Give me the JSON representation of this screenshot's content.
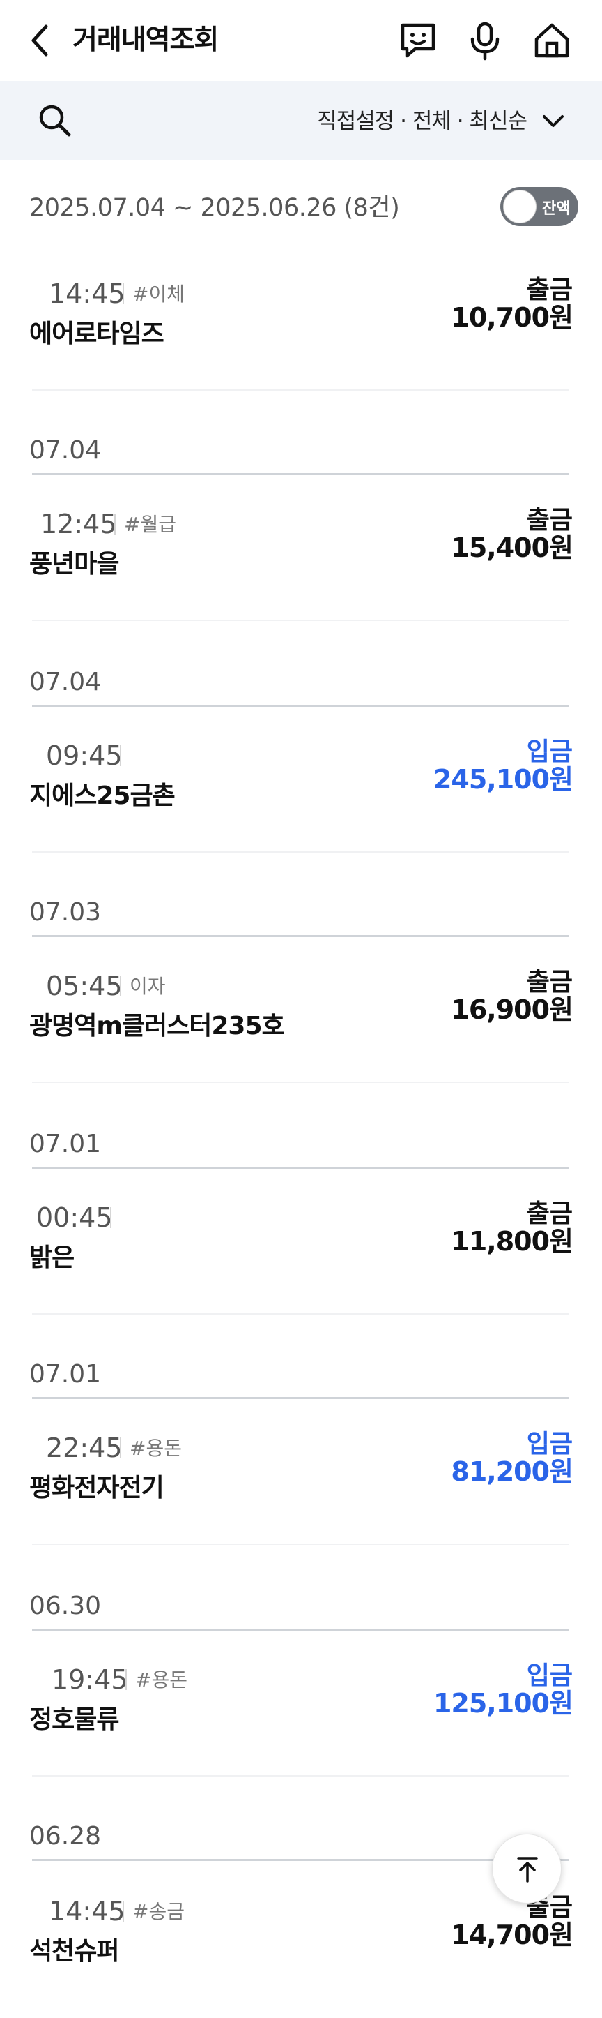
{
  "header": {
    "title": "거래내역조회",
    "icons": [
      "back-icon",
      "chatbot-icon",
      "microphone-icon",
      "home-icon"
    ]
  },
  "filter": {
    "label": "직접설정 · 전체 · 최신순",
    "icons": [
      "search-icon",
      "chevron-down-icon"
    ]
  },
  "summary": {
    "range": "2025.07.04 ~ 2025.06.26 (8건)",
    "balance_toggle_label": "잔액",
    "balance_toggle_on": false
  },
  "colors": {
    "withdraw": "#111111",
    "deposit": "#2a64e8",
    "filter_bg": "#f1f4f9"
  },
  "transactions": [
    {
      "time": "14:45",
      "tag": "#이체",
      "name": "에어로타임즈",
      "type": "출금",
      "amount": "10,700원",
      "kind": "withdraw"
    },
    {
      "date": "07.04",
      "time": "12:45",
      "tag": "#월급",
      "name": "풍년마을",
      "type": "출금",
      "amount": "15,400원",
      "kind": "withdraw"
    },
    {
      "date": "07.04",
      "time": "09:45",
      "tag": "",
      "name": "지에스25금촌",
      "type": "입금",
      "amount": "245,100원",
      "kind": "deposit"
    },
    {
      "date": "07.03",
      "time": "05:45",
      "tag": "이자",
      "name": "광명역m클러스터235호",
      "type": "출금",
      "amount": "16,900원",
      "kind": "withdraw"
    },
    {
      "date": "07.01",
      "time": "00:45",
      "tag": "",
      "name": "밝은",
      "type": "출금",
      "amount": "11,800원",
      "kind": "withdraw"
    },
    {
      "date": "07.01",
      "time": "22:45",
      "tag": "#용돈",
      "name": "평화전자전기",
      "type": "입금",
      "amount": "81,200원",
      "kind": "deposit"
    },
    {
      "date": "06.30",
      "time": "19:45",
      "tag": "#용돈",
      "name": "정호물류",
      "type": "입금",
      "amount": "125,100원",
      "kind": "deposit"
    },
    {
      "date": "06.28",
      "time": "14:45",
      "tag": "#송금",
      "name": "석천슈퍼",
      "type": "출금",
      "amount": "14,700원",
      "kind": "withdraw"
    }
  ],
  "scroll_top_icon": "arrow-up-icon"
}
